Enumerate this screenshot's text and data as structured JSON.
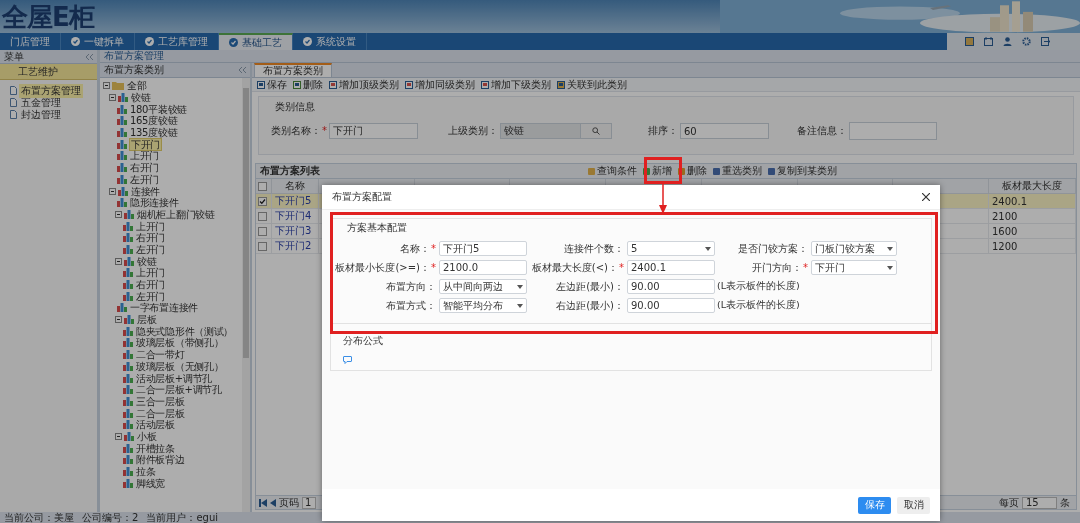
{
  "header": {
    "logo": "全屋E柜"
  },
  "nav": {
    "tabs": [
      {
        "label": "门店管理",
        "kind": "plain",
        "selected": false
      },
      {
        "label": "一键拆单",
        "kind": "icon",
        "selected": false
      },
      {
        "label": "工艺库管理",
        "kind": "icon",
        "selected": false
      },
      {
        "label": "基础工艺",
        "kind": "icon",
        "selected": true
      },
      {
        "label": "系统设置",
        "kind": "icon",
        "selected": false
      }
    ]
  },
  "sidebar": {
    "title": "菜单",
    "section": "工艺维护",
    "items": [
      {
        "label": "布置方案管理",
        "selected": true
      },
      {
        "label": "五金管理",
        "selected": false
      },
      {
        "label": "封边管理",
        "selected": false
      }
    ]
  },
  "breadcrumb": "布置方案管理",
  "tree": {
    "title": "布置方案类别",
    "items": [
      {
        "label": "全部",
        "kind": "folder",
        "selected": false,
        "expanded": true,
        "children": [
          {
            "label": "铰链",
            "kind": "category",
            "selected": false,
            "expanded": true,
            "children": [
              {
                "label": "180平装铰链",
                "kind": "category",
                "selected": false
              },
              {
                "label": "165度铰链",
                "kind": "category",
                "selected": false
              },
              {
                "label": "135度铰链",
                "kind": "category",
                "selected": false
              },
              {
                "label": "下开门",
                "kind": "category",
                "selected": true
              },
              {
                "label": "上开门",
                "kind": "category",
                "selected": false
              },
              {
                "label": "右开门",
                "kind": "category",
                "selected": false
              },
              {
                "label": "左开门",
                "kind": "category",
                "selected": false
              }
            ]
          },
          {
            "label": "连接件",
            "kind": "category",
            "selected": false,
            "expanded": true,
            "children": [
              {
                "label": "隐形连接件",
                "kind": "category",
                "selected": false
              },
              {
                "label": "烟机柜上翻门铰链",
                "kind": "category",
                "selected": false,
                "expanded": true,
                "children": [
                  {
                    "label": "上开门",
                    "kind": "category",
                    "selected": false
                  },
                  {
                    "label": "右开门",
                    "kind": "category",
                    "selected": false
                  },
                  {
                    "label": "左开门",
                    "kind": "category",
                    "selected": false
                  }
                ]
              },
              {
                "label": "铰链",
                "kind": "category",
                "selected": false,
                "expanded": true,
                "children": [
                  {
                    "label": "上开门",
                    "kind": "category",
                    "selected": false
                  },
                  {
                    "label": "右开门",
                    "kind": "category",
                    "selected": false
                  },
                  {
                    "label": "左开门",
                    "kind": "category",
                    "selected": false
                  }
                ]
              },
              {
                "label": "一字布置连接件",
                "kind": "category",
                "selected": false
              },
              {
                "label": "层板",
                "kind": "category",
                "selected": false,
                "expanded": true,
                "children": [
                  {
                    "label": "隐夹式隐形件（测试）",
                    "kind": "category",
                    "selected": false
                  },
                  {
                    "label": "玻璃层板（带侧孔）",
                    "kind": "category",
                    "selected": false
                  },
                  {
                    "label": "二合一带灯",
                    "kind": "category",
                    "selected": false
                  },
                  {
                    "label": "玻璃层板（无侧孔）",
                    "kind": "category",
                    "selected": false
                  },
                  {
                    "label": "活动层板+调节孔",
                    "kind": "category",
                    "selected": false
                  },
                  {
                    "label": "二合一层板+调节孔",
                    "kind": "category",
                    "selected": false
                  },
                  {
                    "label": "三合一层板",
                    "kind": "category",
                    "selected": false
                  },
                  {
                    "label": "二合一层板",
                    "kind": "category",
                    "selected": false
                  },
                  {
                    "label": "活动层板",
                    "kind": "category",
                    "selected": false
                  }
                ]
              },
              {
                "label": "小板",
                "kind": "category",
                "selected": false,
                "expanded": true,
                "children": [
                  {
                    "label": "开槽拉条",
                    "kind": "category",
                    "selected": false
                  },
                  {
                    "label": "附件板背边",
                    "kind": "category",
                    "selected": false
                  },
                  {
                    "label": "拉条",
                    "kind": "category",
                    "selected": false
                  },
                  {
                    "label": "脚线宽",
                    "kind": "category",
                    "selected": false
                  }
                ]
              }
            ]
          }
        ]
      }
    ]
  },
  "main": {
    "tabs": [
      {
        "label": "布置方案类别",
        "selected": true
      }
    ],
    "toolbar": [
      "保存",
      "删除",
      "增加顶级类别",
      "增加同级类别",
      "增加下级类别",
      "关联到此类别"
    ],
    "category_info": {
      "title": "类别信息",
      "fields": [
        {
          "label": "类别名称：",
          "mark": "*",
          "kind": "input",
          "value": "下开门"
        },
        {
          "label": "上级类别：",
          "kind": "lookup",
          "value": "铰链"
        },
        {
          "label": "排序：",
          "kind": "input",
          "value": "60"
        },
        {
          "label": "备注信息：",
          "kind": "textarea"
        }
      ]
    },
    "list": {
      "title": "布置方案列表",
      "actions": [
        "查询条件",
        "新增",
        "删除",
        "重选类别",
        "复制到某类别"
      ],
      "all_checked": false,
      "columns": [
        "名称",
        "板材最大长度"
      ],
      "rows": [
        {
          "name": "下开门5",
          "max_length": "2400.1",
          "checked": true,
          "selected": true
        },
        {
          "name": "下开门4",
          "max_length": "2100",
          "checked": false,
          "selected": false
        },
        {
          "name": "下开门3",
          "max_length": "1600",
          "checked": false,
          "selected": false
        },
        {
          "name": "下开门2",
          "max_length": "1200",
          "checked": false,
          "selected": false
        }
      ]
    },
    "pager": {
      "page_label": "页码",
      "page": "1",
      "per_page_label": "每页",
      "per_page": "15",
      "unit": "条"
    }
  },
  "dialog": {
    "title": "布置方案配置",
    "section": "方案基本配置",
    "rows": [
      [
        {
          "label": "名称：",
          "mark": "*",
          "kind": "input",
          "value": "下开门5"
        },
        {
          "label": "连接件个数：",
          "kind": "select",
          "value": "5"
        },
        {
          "label": "是否门铰方案：",
          "kind": "select",
          "value": "门板门铰方案"
        }
      ],
      [
        {
          "label": "板材最小长度(>=)：",
          "mark": "*",
          "kind": "input",
          "value": "2100.0"
        },
        {
          "label": "板材最大长度(<)：",
          "mark": "*",
          "kind": "input",
          "value": "2400.1"
        },
        {
          "label": "开门方向：",
          "mark": "*",
          "kind": "select",
          "value": "下开门"
        }
      ],
      [
        {
          "label": "布置方向：",
          "kind": "select",
          "value": "从中间向两边"
        },
        {
          "label": "左边距(最小)：",
          "kind": "input",
          "value": "90.00",
          "hint": "(L表示板件的长度)"
        }
      ],
      [
        {
          "label": "布置方式：",
          "kind": "select",
          "value": "智能平均分布"
        },
        {
          "label": "右边距(最小)：",
          "kind": "input",
          "value": "90.00",
          "hint": "(L表示板件的长度)"
        }
      ]
    ],
    "formula_section": "分布公式",
    "buttons": [
      {
        "label": "保存",
        "kind": "primary"
      },
      {
        "label": "取消",
        "kind": "secondary"
      }
    ]
  },
  "status_bar": [
    "当前公司：美屋",
    "公司编号：2",
    "当前用户：egui"
  ]
}
